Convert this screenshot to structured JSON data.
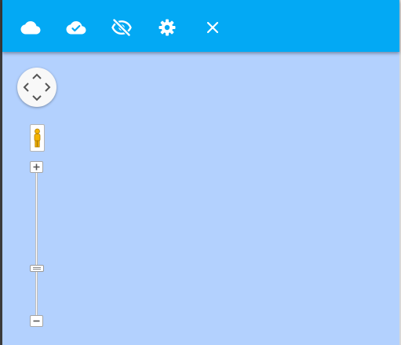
{
  "colors": {
    "toolbar": "#03a9f4",
    "map_background": "#b3d1fe",
    "icon": "#ffffff",
    "pegman": "#f5b400"
  },
  "toolbar": {
    "buttons": [
      {
        "icon": "cloud-icon"
      },
      {
        "icon": "cloud-check-icon"
      },
      {
        "icon": "eye-off-icon"
      },
      {
        "icon": "gear-icon"
      },
      {
        "icon": "close-icon"
      }
    ]
  },
  "map_controls": {
    "pan": [
      "pan-up-icon",
      "pan-left-icon",
      "pan-right-icon",
      "pan-down-icon"
    ],
    "street_view": "pegman-icon",
    "zoom": {
      "in_icon": "plus-icon",
      "out_icon": "minus-icon",
      "level": 0.34
    }
  }
}
